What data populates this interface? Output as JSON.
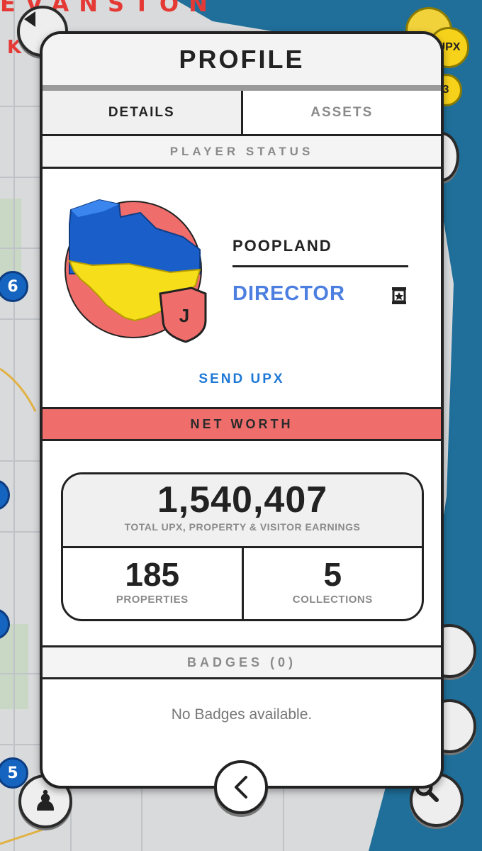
{
  "map": {
    "city_label": "EVANSTON",
    "city_label2": "K I",
    "pins": [
      "6",
      "5"
    ],
    "coin_label": "UPX",
    "coin_small": "3",
    "colors": {
      "water": "#1f6f9a",
      "land": "#d9dadb",
      "pin": "#1565c0"
    }
  },
  "profile": {
    "title": "PROFILE",
    "tabs": [
      {
        "label": "DETAILS",
        "active": true
      },
      {
        "label": "ASSETS",
        "active": false
      }
    ],
    "player_status_header": "PLAYER STATUS",
    "player_name": "POOPLAND",
    "player_rank": "DIRECTOR",
    "avatar_badge": "J",
    "send_upx_label": "SEND UPX",
    "net_worth_header": "NET WORTH",
    "net_worth": {
      "total_value": "1,540,407",
      "total_caption": "TOTAL UPX, PROPERTY & VISITOR EARNINGS",
      "properties_value": "185",
      "properties_label": "PROPERTIES",
      "collections_value": "5",
      "collections_label": "COLLECTIONS"
    },
    "badges_header": "BADGES (0)",
    "no_badges_text": "No Badges available.",
    "colors": {
      "accent_red": "#ef6e6c",
      "rank_blue": "#4c7fe0",
      "link_blue": "#1e78d6"
    }
  }
}
